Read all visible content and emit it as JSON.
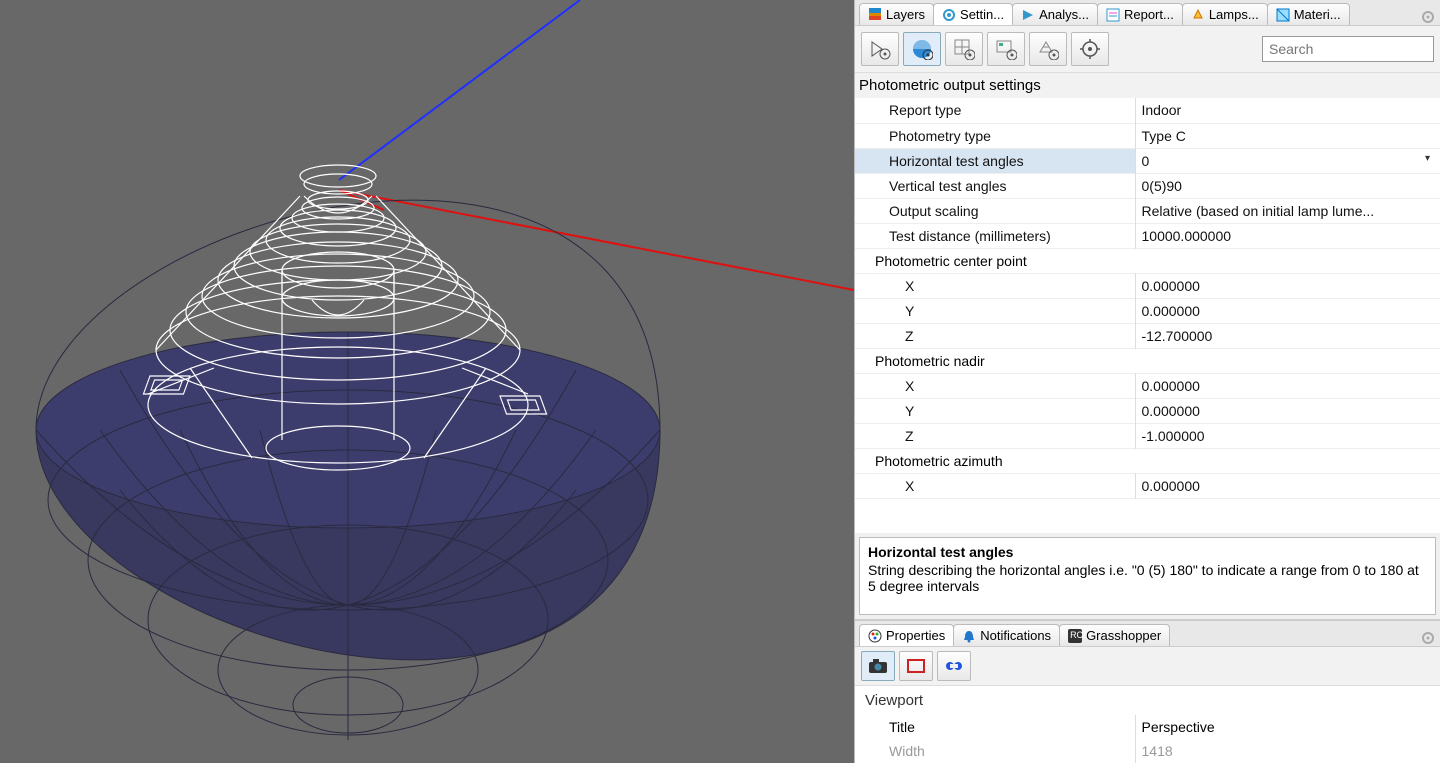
{
  "tabs_top": [
    {
      "label": "Layers"
    },
    {
      "label": "Settin..."
    },
    {
      "label": "Analys..."
    },
    {
      "label": "Report..."
    },
    {
      "label": "Lamps..."
    },
    {
      "label": "Materi..."
    }
  ],
  "search": {
    "placeholder": "Search"
  },
  "section_title": "Photometric output settings",
  "props": {
    "report_type": {
      "label": "Report type",
      "value": "Indoor"
    },
    "photometry_type": {
      "label": "Photometry type",
      "value": "Type C"
    },
    "horizontal_test_angles": {
      "label": "Horizontal test angles",
      "value": "0"
    },
    "vertical_test_angles": {
      "label": "Vertical test angles",
      "value": "0(5)90"
    },
    "output_scaling": {
      "label": "Output scaling",
      "value": "Relative (based on initial lamp lume..."
    },
    "test_distance": {
      "label": "Test distance (millimeters)",
      "value": "10000.000000"
    },
    "center_point_group": "Photometric center point",
    "cp_x": {
      "label": "X",
      "value": "0.000000"
    },
    "cp_y": {
      "label": "Y",
      "value": "0.000000"
    },
    "cp_z": {
      "label": "Z",
      "value": "-12.700000"
    },
    "nadir_group": "Photometric nadir",
    "na_x": {
      "label": "X",
      "value": "0.000000"
    },
    "na_y": {
      "label": "Y",
      "value": "0.000000"
    },
    "na_z": {
      "label": "Z",
      "value": "-1.000000"
    },
    "azimuth_group": "Photometric azimuth",
    "az_x": {
      "label": "X",
      "value": "0.000000"
    }
  },
  "description": {
    "title": "Horizontal test angles",
    "body": "String describing the horizontal angles  i.e.  \"0 (5) 180\" to indicate a range from 0 to 180 at 5 degree intervals"
  },
  "tabs_bottom": [
    {
      "label": "Properties"
    },
    {
      "label": "Notifications"
    },
    {
      "label": "Grasshopper"
    }
  ],
  "viewport_section": {
    "title": "Viewport",
    "title_row": {
      "label": "Title",
      "value": "Perspective"
    },
    "width_row": {
      "label": "Width",
      "value": "1418"
    }
  }
}
